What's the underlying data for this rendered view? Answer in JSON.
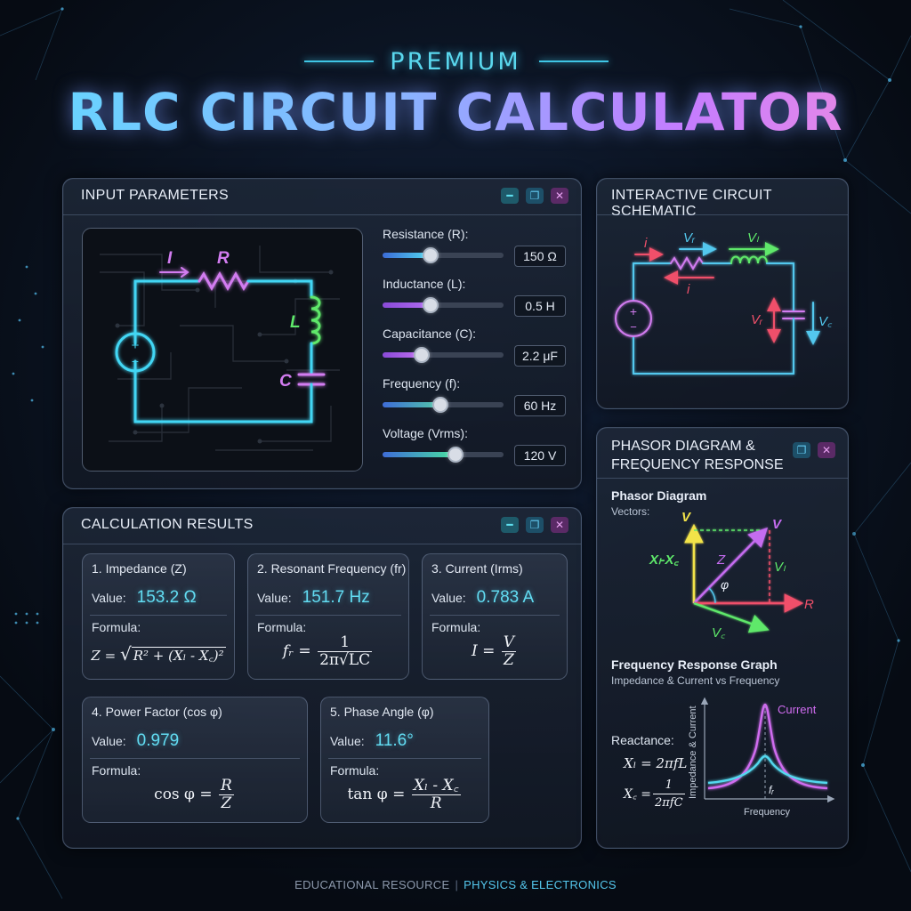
{
  "header": {
    "premium": "PREMIUM",
    "title": "RLC CIRCUIT CALCULATOR"
  },
  "input_panel": {
    "title": "INPUT PARAMETERS",
    "schematic_labels": {
      "current": "I",
      "resistor": "R",
      "inductor": "L",
      "capacitor": "C"
    },
    "params": [
      {
        "label": "Resistance (R):",
        "value": "150 Ω",
        "level": 0.4
      },
      {
        "label": "Inductance (L):",
        "value": "0.5 H",
        "level": 0.4
      },
      {
        "label": "Capacitance (C):",
        "value": "2.2 μF",
        "level": 0.32
      },
      {
        "label": "Frequency (f):",
        "value": "60 Hz",
        "level": 0.48
      },
      {
        "label": "Voltage (Vrms):",
        "value": "120 V",
        "level": 0.6
      }
    ]
  },
  "schematic_panel": {
    "title": "INTERACTIVE CIRCUIT SCHEMATIC",
    "labels": {
      "i_top": "i",
      "vr": "Vᵣ",
      "vl": "Vₗ",
      "i_bottom": "i",
      "vr_side": "Vᵣ",
      "vc": "V꜀"
    }
  },
  "results_panel": {
    "title": "CALCULATION RESULTS",
    "value_label": "Value:",
    "formula_label": "Formula:",
    "cards": [
      {
        "title": "1. Impedance (Z)",
        "value": "153.2 Ω"
      },
      {
        "title": "2. Resonant Frequency (fr)",
        "value": "151.7 Hz"
      },
      {
        "title": "3. Current (Irms)",
        "value": "0.783 A"
      },
      {
        "title": "4. Power Factor (cos φ)",
        "value": "0.979"
      },
      {
        "title": "5. Phase Angle (φ)",
        "value": "11.6°"
      }
    ],
    "formulas": {
      "z_lhs": "Z =",
      "z_rad": "R² + (Xₗ - X꜀)²",
      "fr_lhs": "fᵣ =",
      "fr_num": "1",
      "fr_den": "2π√LC",
      "i_lhs": "I =",
      "i_num": "V",
      "i_den": "Z",
      "pf_lhs": "cos φ =",
      "pf_num": "R",
      "pf_den": "Z",
      "pa_lhs": "tan φ =",
      "pa_num": "Xₗ - X꜀",
      "pa_den": "R"
    }
  },
  "phasor_panel": {
    "title_line1": "PHASOR DIAGRAM &",
    "title_line2": "FREQUENCY RESPONSE",
    "phasor_title": "Phasor Diagram",
    "phasor_sub": "Vectors:",
    "vec_labels": {
      "v_up": "V",
      "v_diag": "V",
      "xl_xc": "Xₗ-X꜀",
      "z": "Z",
      "phi": "φ",
      "vl": "Vₗ",
      "r": "R",
      "vc": "V꜀"
    },
    "freq_title": "Frequency Response Graph",
    "freq_sub": "Impedance & Current vs Frequency",
    "reactance_label": "Reactance:",
    "xl_formula_lhs": "Xₗ = 2πfL",
    "xc_lhs": "X꜀ =",
    "xc_num": "1",
    "xc_den": "2πfC",
    "graph": {
      "ylabel": "Impedance & Current",
      "xlabel": "Frequency",
      "series_label": "Current",
      "marker": "fᵣ"
    }
  },
  "footer": {
    "left": "EDUCATIONAL RESOURCE",
    "sep": "|",
    "right": "PHYSICS & ELECTRONICS"
  },
  "colors": {
    "accent_cyan": "#52d8ee",
    "accent_purple": "#c56cf0",
    "accent_green": "#5ee86a",
    "accent_red": "#f0506a"
  },
  "window_icons": [
    "minimize-icon",
    "restore-icon",
    "close-icon"
  ]
}
